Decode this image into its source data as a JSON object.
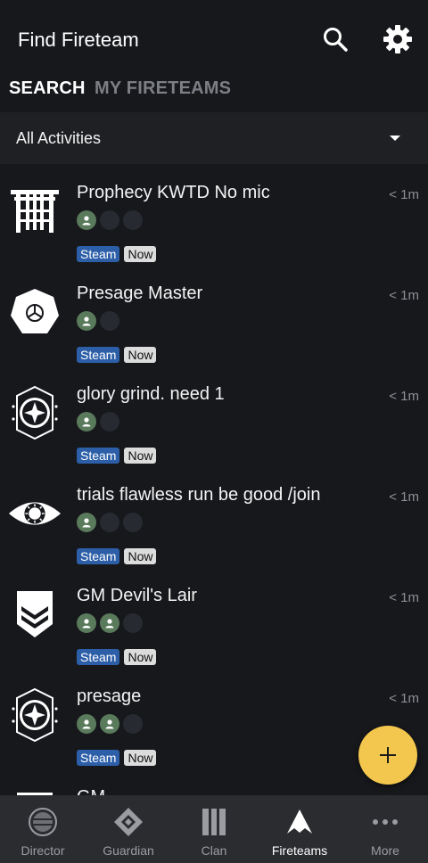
{
  "header": {
    "title": "Find Fireteam",
    "search_icon": "search-icon",
    "settings_icon": "gear-icon"
  },
  "tabs": [
    {
      "label": "SEARCH",
      "active": true
    },
    {
      "label": "MY FIRETEAMS",
      "active": false
    }
  ],
  "filter": {
    "selected": "All Activities"
  },
  "fireteams": [
    {
      "title": "Prophecy KWTD No mic",
      "time": "< 1m",
      "filled": 1,
      "slots": 3,
      "platform": "Steam",
      "when": "Now",
      "emblem": "prophecy-gate-icon"
    },
    {
      "title": "Presage Master",
      "time": "< 1m",
      "filled": 1,
      "slots": 2,
      "platform": "Steam",
      "when": "Now",
      "emblem": "dodecahedron-icon"
    },
    {
      "title": "glory grind. need 1",
      "time": "< 1m",
      "filled": 1,
      "slots": 2,
      "platform": "Steam",
      "when": "Now",
      "emblem": "crucible-star-icon"
    },
    {
      "title": "trials flawless run be good /join",
      "time": "< 1m",
      "filled": 1,
      "slots": 3,
      "platform": "Steam",
      "when": "Now",
      "emblem": "trials-eye-icon"
    },
    {
      "title": "GM Devil's Lair",
      "time": "< 1m",
      "filled": 2,
      "slots": 3,
      "platform": "Steam",
      "when": "Now",
      "emblem": "vanguard-shield-icon"
    },
    {
      "title": "presage",
      "time": "< 1m",
      "filled": 2,
      "slots": 3,
      "platform": "Steam",
      "when": "Now",
      "emblem": "crucible-star-icon"
    },
    {
      "title": "GM ...",
      "time": "",
      "filled": 0,
      "slots": 0,
      "platform": "",
      "when": "",
      "emblem": "vanguard-shield-icon"
    }
  ],
  "fab": {
    "icon": "plus-icon",
    "color": "#f3c74e"
  },
  "nav": [
    {
      "label": "Director",
      "icon": "director-icon",
      "active": false
    },
    {
      "label": "Guardian",
      "icon": "guardian-icon",
      "active": false
    },
    {
      "label": "Clan",
      "icon": "clan-icon",
      "active": false
    },
    {
      "label": "Fireteams",
      "icon": "fireteams-icon",
      "active": true
    },
    {
      "label": "More",
      "icon": "more-icon",
      "active": false
    }
  ]
}
